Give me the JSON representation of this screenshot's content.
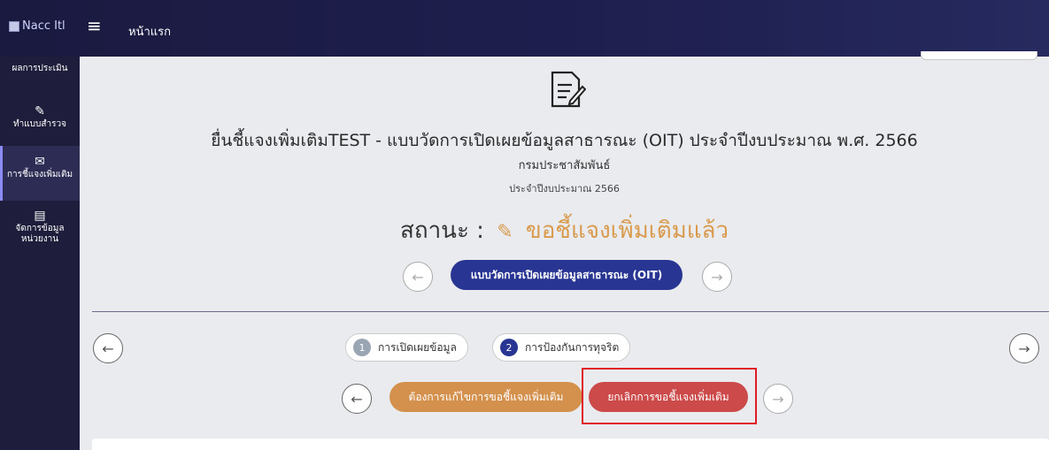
{
  "topbar": {
    "logo_alt": "Nacc Itl",
    "menu_icon": "hamburger-icon",
    "home_label": "หน้าแรก"
  },
  "sidebar": {
    "items": [
      {
        "label": "ผลการประเมิน",
        "icon": "chart-icon"
      },
      {
        "label": "ทำแบบสำรวจ",
        "icon": "edit-icon"
      },
      {
        "label": "การชี้แจงเพิ่มเติม",
        "icon": "envelope-icon"
      },
      {
        "label": "จัดการข้อมูลหน่วยงาน",
        "icon": "clipboard-icon"
      }
    ]
  },
  "main": {
    "title": "ยื่นชี้แจงเพิ่มเติมTEST - แบบวัดการเปิดเผยข้อมูลสาธารณะ (OIT) ประจำปีงบประมาณ พ.ศ. 2566",
    "agency": "กรมประชาสัมพันธ์",
    "fiscal": "ประจำปีงบประมาณ 2566",
    "status_label": "สถานะ :",
    "status_value": "ขอชี้แจงเพิ่มเติมแล้ว",
    "survey_label": "แบบวัดการเปิดเผยข้อมูลสาธารณะ (OIT)",
    "steps": [
      {
        "num": "1",
        "label": "การเปิดเผยข้อมูล"
      },
      {
        "num": "2",
        "label": "การป้องกันการทุจริต"
      }
    ],
    "edit_button": "ต้องการแก้ไขการขอชี้แจงเพิ่มเติม",
    "cancel_button": "ยกเลิกการขอชี้แจงเพิ่มเติม"
  },
  "colors": {
    "accent": "#283593",
    "status": "#d99a4c",
    "edit": "#d4914d",
    "cancel": "#cc4a4a",
    "highlight": "#e01b24"
  }
}
